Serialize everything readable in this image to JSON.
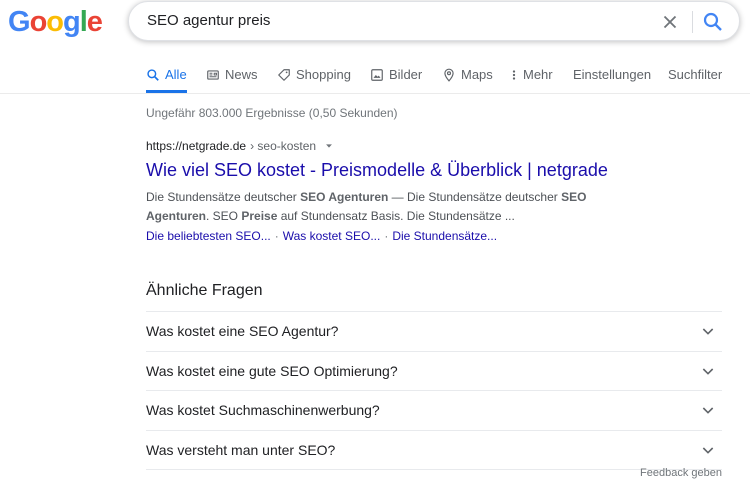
{
  "logo": {
    "letters": [
      "G",
      "o",
      "o",
      "g",
      "l",
      "e"
    ],
    "colors": [
      "#4285f4",
      "#ea4335",
      "#fbbc05",
      "#4285f4",
      "#34a853",
      "#ea4335"
    ]
  },
  "search": {
    "query": "SEO agentur preis"
  },
  "tabs": [
    {
      "label": "Alle",
      "icon": "search-icon",
      "active": true
    },
    {
      "label": "News",
      "icon": "news-icon"
    },
    {
      "label": "Shopping",
      "icon": "tag-icon"
    },
    {
      "label": "Bilder",
      "icon": "image-icon"
    },
    {
      "label": "Maps",
      "icon": "map-pin-icon"
    },
    {
      "label": "Mehr",
      "icon": "more-vert-icon"
    },
    {
      "label": "Einstellungen"
    },
    {
      "label": "Suchfilter"
    }
  ],
  "stats": "Ungefähr 803.000 Ergebnisse (0,50 Sekunden)",
  "result": {
    "domain": "https://netgrade.de",
    "path": " › seo-kosten",
    "title": "Wie viel SEO kostet - Preismodelle & Überblick | netgrade",
    "snippet": {
      "p1": "Die Stundensätze deutscher ",
      "b1": "SEO Agenturen",
      "p2": " — Die Stundensätze deutscher ",
      "b2": "SEO Agenturen",
      "p3": ". SEO ",
      "b3": "Preise",
      "p4": " auf Stundensatz Basis. Die Stundensätze ..."
    },
    "sitelinks": [
      "Die beliebtesten SEO...",
      "Was kostet SEO...",
      "Die Stundensätze..."
    ],
    "separator": "·"
  },
  "paa": {
    "title": "Ähnliche Fragen",
    "questions": [
      "Was kostet eine SEO Agentur?",
      "Was kostet eine gute SEO Optimierung?",
      "Was kostet Suchmaschinenwerbung?",
      "Was versteht man unter SEO?"
    ]
  },
  "feedback": "Feedback geben",
  "colors": {
    "accent": "#1a73e8",
    "link": "#1a0dab"
  }
}
